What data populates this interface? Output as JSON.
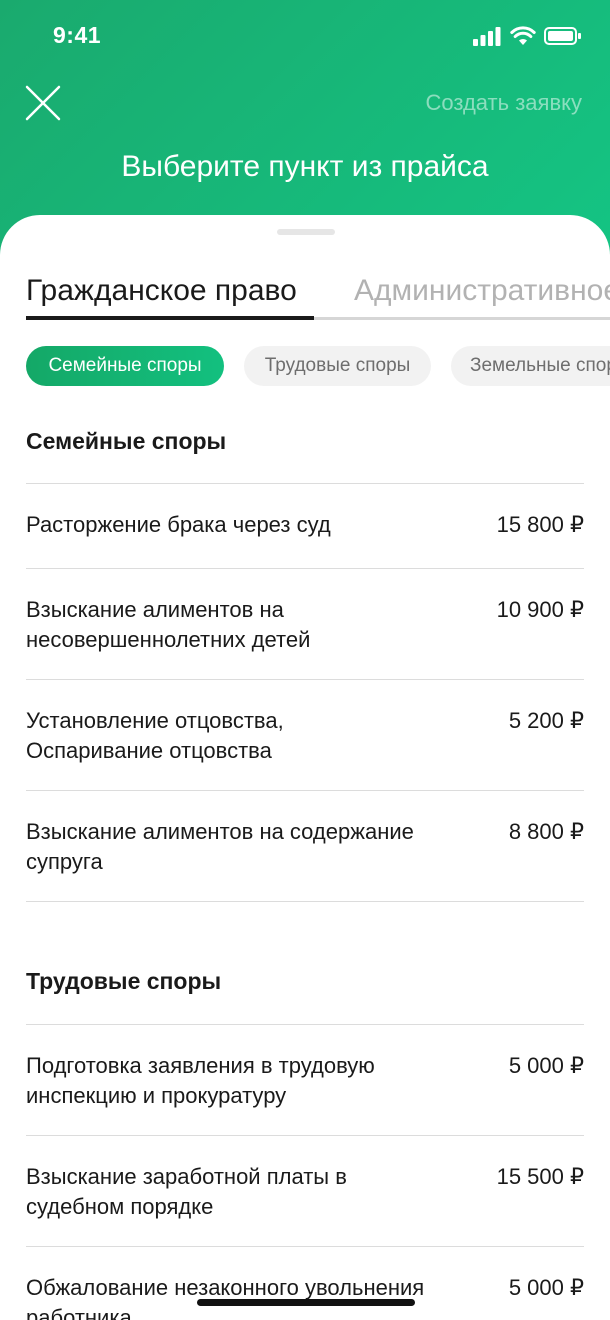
{
  "status_bar": {
    "time": "9:41"
  },
  "header": {
    "close_icon": "close-icon",
    "create_link": "Создать заявку",
    "title": "Выберите пункт из прайса"
  },
  "tabs": [
    {
      "label": "Гражданское право",
      "active": true
    },
    {
      "label": "Административное право",
      "active": false
    }
  ],
  "chips": [
    {
      "label": "Семейные споры",
      "active": true
    },
    {
      "label": "Трудовые споры",
      "active": false
    },
    {
      "label": "Земельные споры",
      "active": false
    }
  ],
  "sections": [
    {
      "title": "Семейные споры",
      "items": [
        {
          "name": "Расторжение брака через суд",
          "price": "15 800 ₽"
        },
        {
          "name": "Взыскание алиментов на несовершеннолетних детей",
          "price": "10 900 ₽"
        },
        {
          "name": "Установление отцовства, Оспаривание отцовства",
          "price": "5 200 ₽"
        },
        {
          "name": "Взыскание алиментов на содержание супруга",
          "price": "8 800 ₽"
        }
      ]
    },
    {
      "title": "Трудовые споры",
      "items": [
        {
          "name": "Подготовка заявления в трудовую инспекцию и прокуратуру",
          "price": "5 000 ₽"
        },
        {
          "name": "Взыскание заработной платы в судебном порядке",
          "price": "15 500 ₽"
        },
        {
          "name": "Обжалование незаконного увольнения работника",
          "price": "5 000 ₽"
        }
      ]
    }
  ],
  "colors": {
    "brand_green": "#14c584",
    "brand_green_dark": "#1aaa6e"
  }
}
